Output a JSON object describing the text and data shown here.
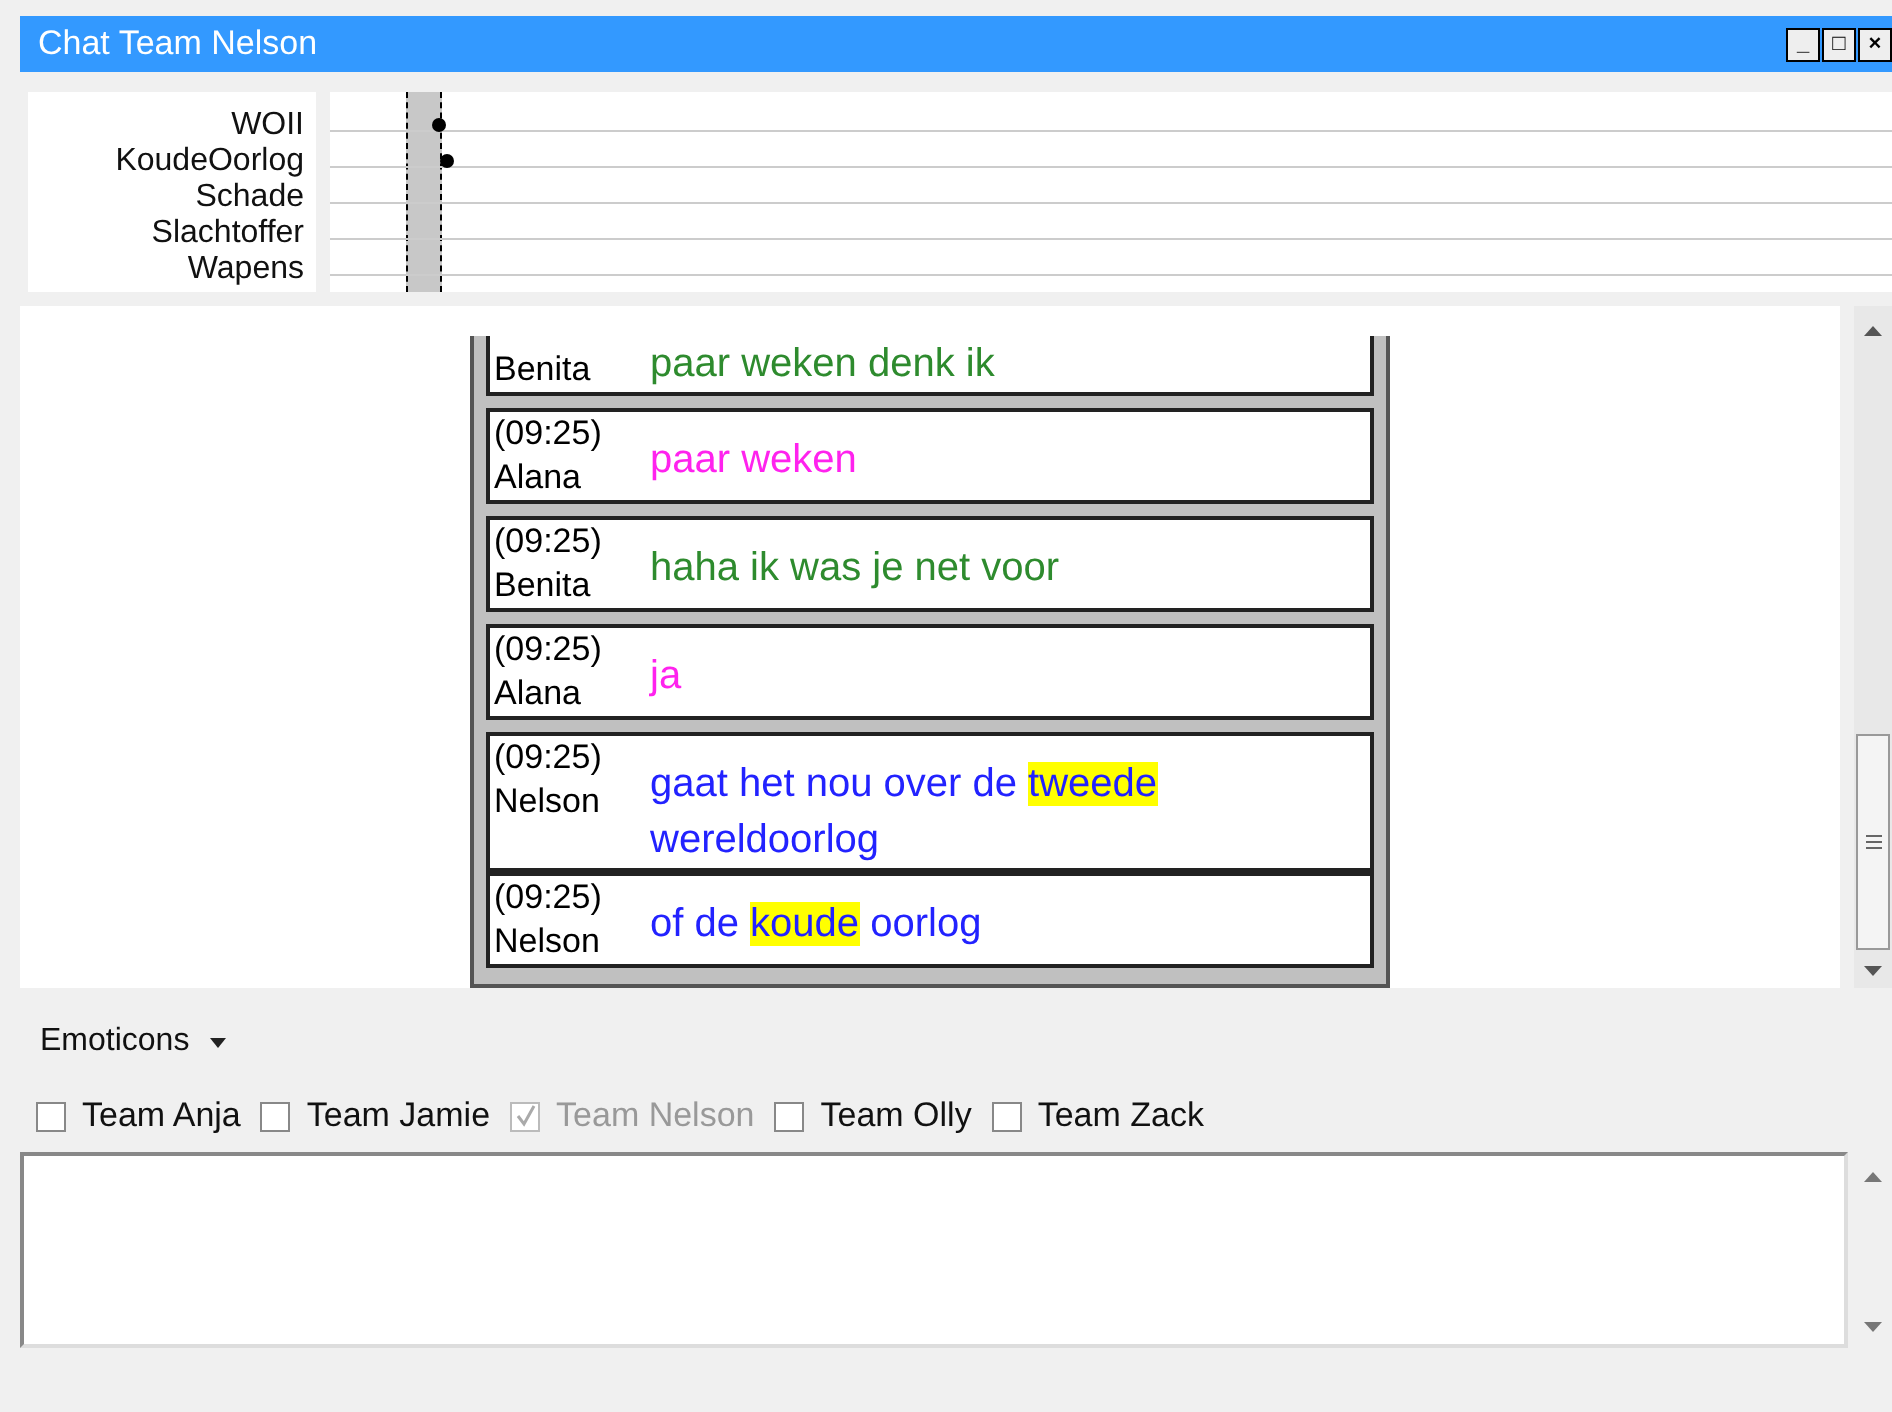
{
  "window": {
    "title": "Chat Team Nelson",
    "controls": [
      "_",
      "□",
      "×"
    ]
  },
  "timeline": {
    "topics": [
      {
        "label": "WOII",
        "marked": true
      },
      {
        "label": "KoudeOorlog",
        "marked": true
      },
      {
        "label": "Schade",
        "marked": false
      },
      {
        "label": "Slachtoffer",
        "marked": false
      },
      {
        "label": "Wapens",
        "marked": false
      }
    ]
  },
  "messages": [
    {
      "author": "Benita",
      "color": "#2e8b2e",
      "parts": [
        {
          "text": "paar weken denk ik",
          "highlight": false
        }
      ]
    },
    {
      "time": "(09:25)",
      "author": "Alana",
      "color": "#ff22ee",
      "parts": [
        {
          "text": "paar weken",
          "highlight": false
        }
      ]
    },
    {
      "time": "(09:25)",
      "author": "Benita",
      "color": "#2e8b2e",
      "parts": [
        {
          "text": "haha ik was je net voor",
          "highlight": false
        }
      ]
    },
    {
      "time": "(09:25)",
      "author": "Alana",
      "color": "#ff22ee",
      "parts": [
        {
          "text": "ja",
          "highlight": false
        }
      ]
    },
    {
      "time": "(09:25)",
      "author": "Nelson",
      "color": "#2222ff",
      "parts": [
        {
          "text": "gaat het nou over de ",
          "highlight": false
        },
        {
          "text": "tweede",
          "highlight": true
        },
        {
          "text": " wereldoorlog",
          "highlight": false
        }
      ]
    },
    {
      "time": "(09:25)",
      "author": "Nelson",
      "color": "#2222ff",
      "parts": [
        {
          "text": "of de ",
          "highlight": false
        },
        {
          "text": "koude",
          "highlight": true
        },
        {
          "text": " oorlog",
          "highlight": false
        }
      ]
    }
  ],
  "emoticons": {
    "label": "Emoticons"
  },
  "teams": [
    {
      "label": "Team Anja",
      "checked": false,
      "disabled": false
    },
    {
      "label": "Team Jamie",
      "checked": false,
      "disabled": false
    },
    {
      "label": "Team Nelson",
      "checked": true,
      "disabled": true
    },
    {
      "label": "Team Olly",
      "checked": false,
      "disabled": false
    },
    {
      "label": "Team Zack",
      "checked": false,
      "disabled": false
    }
  ]
}
